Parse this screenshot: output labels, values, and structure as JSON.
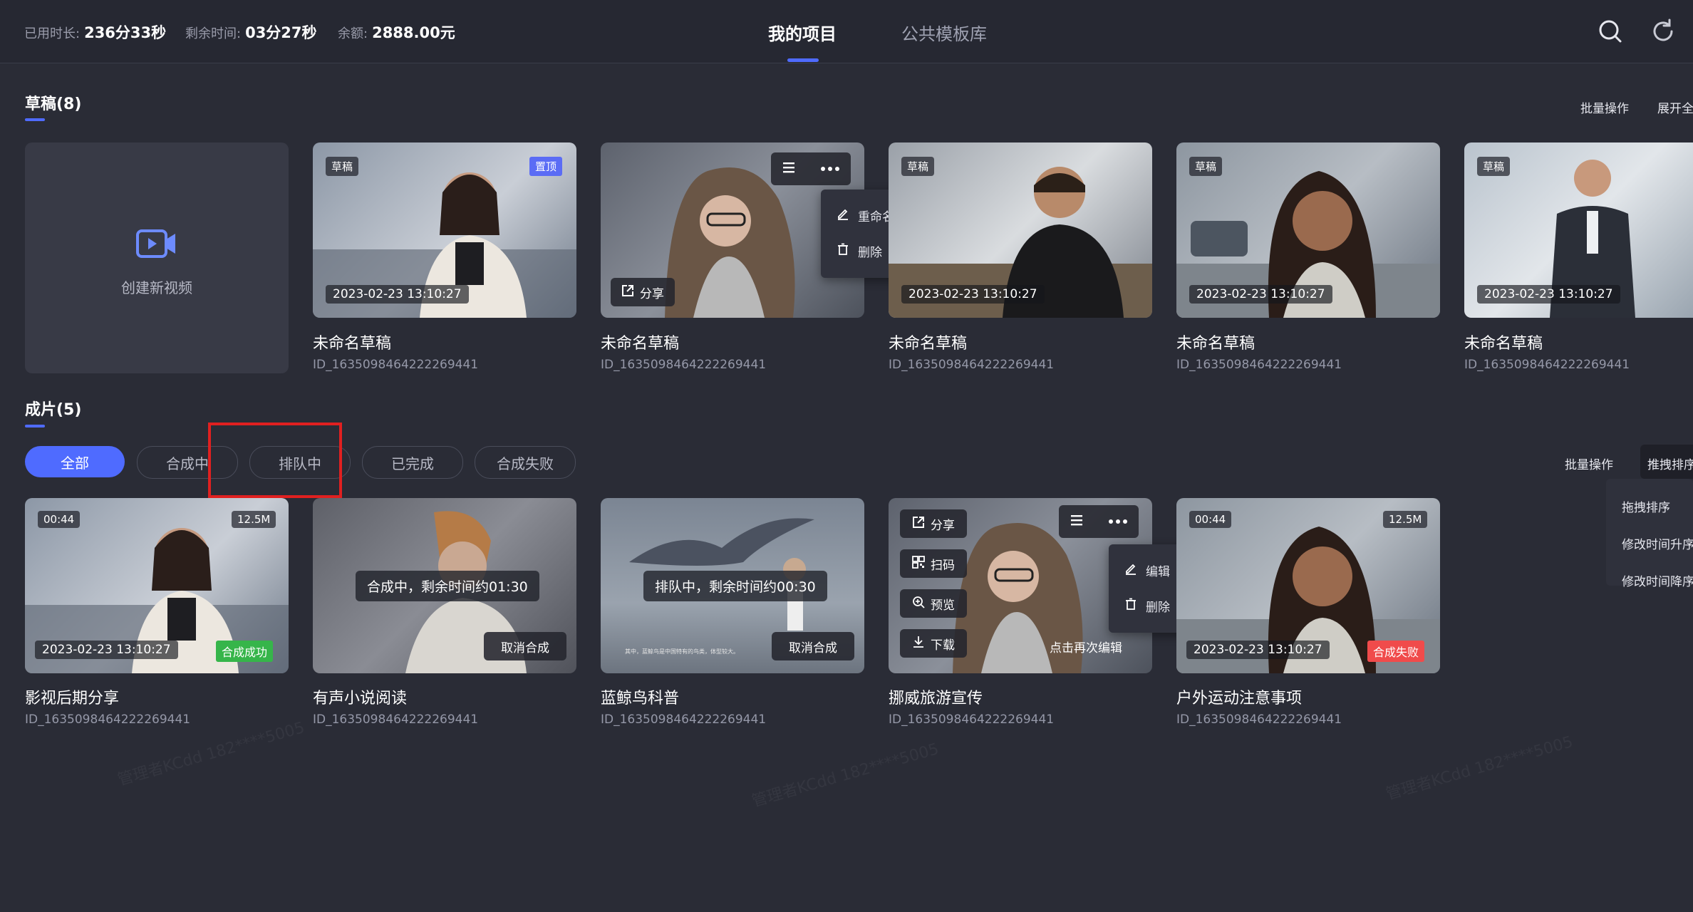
{
  "header": {
    "used_label": "已用时长:",
    "used_value": "236分33秒",
    "remain_label": "剩余时间:",
    "remain_value": "03分27秒",
    "balance_label": "余额:",
    "balance_value": "2888.00元",
    "tabs": [
      {
        "label": "我的项目",
        "active": true
      },
      {
        "label": "公共模板库",
        "active": false
      }
    ]
  },
  "drafts": {
    "title": "草稿(8)",
    "batch": "批量操作",
    "expand": "展开全",
    "create_label": "创建新视频",
    "tag": "草稿",
    "pin": "置顶",
    "share": "分享",
    "menu": [
      "重命名",
      "删除"
    ],
    "cards": [
      {
        "title": "未命名草稿",
        "id": "ID_1635098464222269441",
        "date": "2023-02-23 13:10:27",
        "pinned": true
      },
      {
        "title": "未命名草稿",
        "id": "ID_1635098464222269441",
        "date": "",
        "pinned": false
      },
      {
        "title": "未命名草稿",
        "id": "ID_1635098464222269441",
        "date": "2023-02-23 13:10:27",
        "pinned": false
      },
      {
        "title": "未命名草稿",
        "id": "ID_1635098464222269441",
        "date": "2023-02-23 13:10:27",
        "pinned": false
      },
      {
        "title": "未命名草稿",
        "id": "ID_1635098464222269441",
        "date": "2023-02-23 13:10:27",
        "pinned": false
      }
    ]
  },
  "finished": {
    "title": "成片(5)",
    "batch": "批量操作",
    "drag_sort": "推拽排序",
    "filters": [
      "全部",
      "合成中",
      "排队中",
      "已完成",
      "合成失败"
    ],
    "sort_menu": [
      "拖拽排序",
      "修改时间升序",
      "修改时间降序"
    ],
    "cards": [
      {
        "title": "影视后期分享",
        "id": "ID_1635098464222269441",
        "duration": "00:44",
        "size": "12.5M",
        "date": "2023-02-23 13:10:27",
        "status": "合成成功"
      },
      {
        "title": "有声小说阅读",
        "id": "ID_1635098464222269441",
        "overlay": "合成中，剩余时间约01:30",
        "action": "取消合成"
      },
      {
        "title": "蓝鲸鸟科普",
        "id": "ID_1635098464222269441",
        "overlay": "排队中，剩余时间约00:30",
        "action": "取消合成",
        "subtitle": "其中，蓝鲸鸟是中国特有的鸟类，体型较大。"
      },
      {
        "title": "挪威旅游宣传",
        "id": "ID_1635098464222269441",
        "side_buttons": [
          "分享",
          "扫码",
          "预览",
          "下载"
        ],
        "menu": [
          "编辑",
          "删除"
        ],
        "edit_again": "点击再次编辑"
      },
      {
        "title": "户外运动注意事项",
        "id": "ID_1635098464222269441",
        "duration": "00:44",
        "size": "12.5M",
        "date": "2023-02-23 13:10:27",
        "status": "合成失败"
      }
    ]
  },
  "watermark": "管理者KCdd 182****5005",
  "colors": {
    "accent": "#4f6bff",
    "success": "#36b54a",
    "fail": "#f04b4b",
    "highlight": "#e02020"
  }
}
